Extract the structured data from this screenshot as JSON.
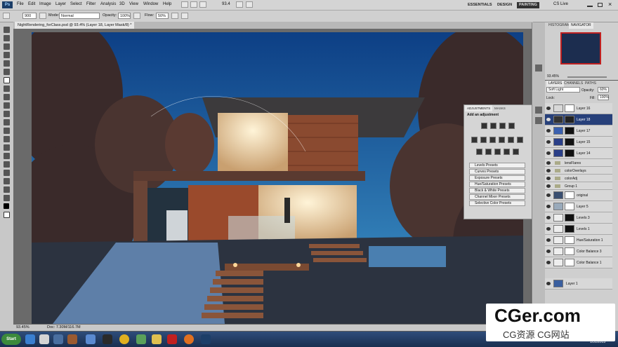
{
  "menubar": {
    "logo": "Ps",
    "items": [
      "File",
      "Edit",
      "Image",
      "Layer",
      "Select",
      "Filter",
      "Analysis",
      "3D",
      "View",
      "Window",
      "Help"
    ],
    "zoom": "93.4",
    "workspaces": [
      "ESSENTIALS",
      "DESIGN",
      "PAINTING"
    ],
    "cs_live": "CS Live"
  },
  "options": {
    "brush_size": "900",
    "mode_label": "Mode:",
    "mode_value": "Normal",
    "opacity_label": "Opacity:",
    "opacity_value": "100%",
    "flow_label": "Flow:",
    "flow_value": "50%"
  },
  "document": {
    "tab_title": "NightRendering_forClass.psd @ 93.4% (Layer 18, Layer Mask/8) *",
    "status_zoom": "93.45%",
    "status_doc": "Doc: 7.30M/116.7M"
  },
  "navigator": {
    "tabs": [
      "HISTOGRAM",
      "NAVIGATOR"
    ],
    "zoom": "93.45%"
  },
  "layers": {
    "tabs": [
      "LAYERS",
      "CHANNELS",
      "PATHS"
    ],
    "blend_mode": "Soft Light",
    "opacity_label": "Opacity:",
    "opacity_value": "60%",
    "lock_label": "Lock:",
    "fill_label": "Fill:",
    "fill_value": "100%",
    "rows": [
      {
        "name": "Layer 16",
        "type": "layer"
      },
      {
        "name": "Layer 18",
        "type": "layer",
        "selected": true
      },
      {
        "name": "Layer 17",
        "type": "layer"
      },
      {
        "name": "Layer 15",
        "type": "layer"
      },
      {
        "name": "Layer 14",
        "type": "layer"
      },
      {
        "name": "lensFlares",
        "type": "folder"
      },
      {
        "name": "colorOverlays",
        "type": "folder"
      },
      {
        "name": "colorAdj",
        "type": "folder"
      },
      {
        "name": "Group 1",
        "type": "folder"
      },
      {
        "name": "original",
        "type": "layer"
      },
      {
        "name": "Layer 5",
        "type": "layer"
      },
      {
        "name": "Levels 3",
        "type": "layer"
      },
      {
        "name": "Levels 1",
        "type": "layer"
      },
      {
        "name": "Hue/Saturation 1",
        "type": "layer"
      },
      {
        "name": "Color Balance 3",
        "type": "layer"
      },
      {
        "name": "Color Balance 1",
        "type": "layer"
      },
      {
        "name": "Layer 1",
        "type": "layer"
      }
    ]
  },
  "adjustments": {
    "tabs": [
      "ADJUSTMENTS",
      "MASKS"
    ],
    "title": "Add an adjustment",
    "presets": [
      "Levels Presets",
      "Curves Presets",
      "Exposure Presets",
      "Hue/Saturation Presets",
      "Black & White Presets",
      "Channel Mixer Presets",
      "Selective Color Presets"
    ]
  },
  "taskbar": {
    "start": "Start",
    "date": "1/31/2015"
  },
  "watermark": {
    "line1": "CGer.com",
    "line2": "CG资源 CG网站"
  },
  "colors": {
    "selected_layer": "#27407a",
    "sky_top": "#0d3f85",
    "sky_bottom": "#3f96c9"
  }
}
